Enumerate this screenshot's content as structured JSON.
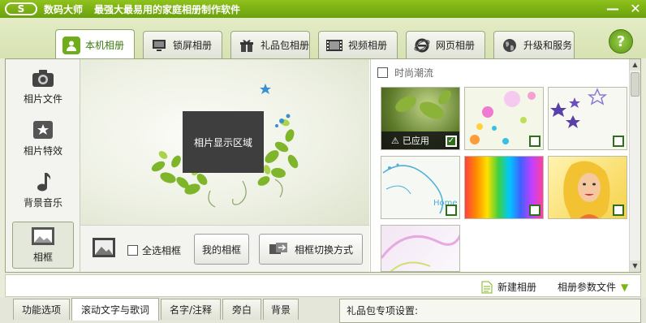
{
  "titlebar": {
    "logo_text": "S",
    "app_name": "数码大师",
    "slogan": "最强大最易用的家庭相册制作软件",
    "minimize_glyph": "—",
    "close_glyph": "✕"
  },
  "tabs": [
    {
      "label": "本机相册",
      "icon": "person-icon",
      "active": true
    },
    {
      "label": "锁屏相册",
      "icon": "monitor-icon"
    },
    {
      "label": "礼品包相册",
      "icon": "gift-icon"
    },
    {
      "label": "视频相册",
      "icon": "film-icon"
    },
    {
      "label": "网页相册",
      "icon": "ie-icon"
    },
    {
      "label": "升级和服务",
      "icon": "globe-icon"
    }
  ],
  "help": {
    "label": "?"
  },
  "sidebar": {
    "items": [
      {
        "label": "相片文件",
        "icon": "camera-icon"
      },
      {
        "label": "相片特效",
        "icon": "effects-icon"
      },
      {
        "label": "背景音乐",
        "icon": "music-note-icon"
      },
      {
        "label": "相框",
        "icon": "frame-icon",
        "active": true
      }
    ]
  },
  "preview": {
    "photo_area_label": "相片显示区域"
  },
  "toolbar": {
    "select_all_label": "全选相框",
    "my_frames_label": "我的相框",
    "switch_mode_label": "相框切换方式"
  },
  "frames_panel": {
    "category_label": "时尚潮流",
    "applied_label": "已应用",
    "thumbnails": [
      {
        "name": "green-leaves",
        "applied": true
      },
      {
        "name": "colorful-bubbles"
      },
      {
        "name": "purple-stars"
      },
      {
        "name": "home-swirl",
        "text": "Home"
      },
      {
        "name": "rainbow-stripes"
      },
      {
        "name": "blonde-girl"
      },
      {
        "name": "pink-swirl"
      }
    ]
  },
  "statusbar": {
    "new_album_label": "新建相册",
    "album_params_label": "相册参数文件"
  },
  "bottom_tabs": [
    {
      "label": "功能选项"
    },
    {
      "label": "滚动文字与歌词",
      "active": true
    },
    {
      "label": "名字/注释"
    },
    {
      "label": "旁白"
    },
    {
      "label": "背景"
    }
  ],
  "gift_settings_label": "礼品包专项设置:",
  "colors": {
    "brand_green": "#7cb518",
    "accent_green": "#3c7a10"
  }
}
